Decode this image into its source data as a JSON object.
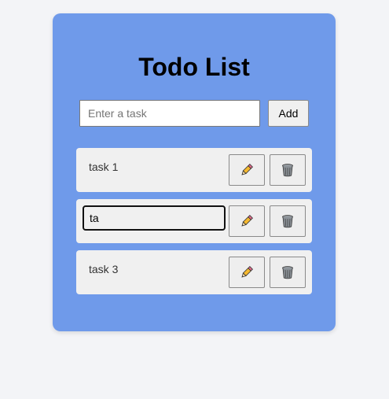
{
  "app": {
    "title": "Todo List"
  },
  "new_task": {
    "placeholder": "Enter a task",
    "value": "",
    "add_label": "Add"
  },
  "tasks": [
    {
      "text": "task 1",
      "editing": false
    },
    {
      "text": "ta",
      "editing": true
    },
    {
      "text": "task 3",
      "editing": false
    }
  ],
  "icons": {
    "edit": "pencil-icon",
    "delete": "wastebasket-icon"
  },
  "colors": {
    "background": "#f3f4f7",
    "card": "#6f9aea",
    "row": "#f0f0f0",
    "pencil": "#f5b82e"
  }
}
